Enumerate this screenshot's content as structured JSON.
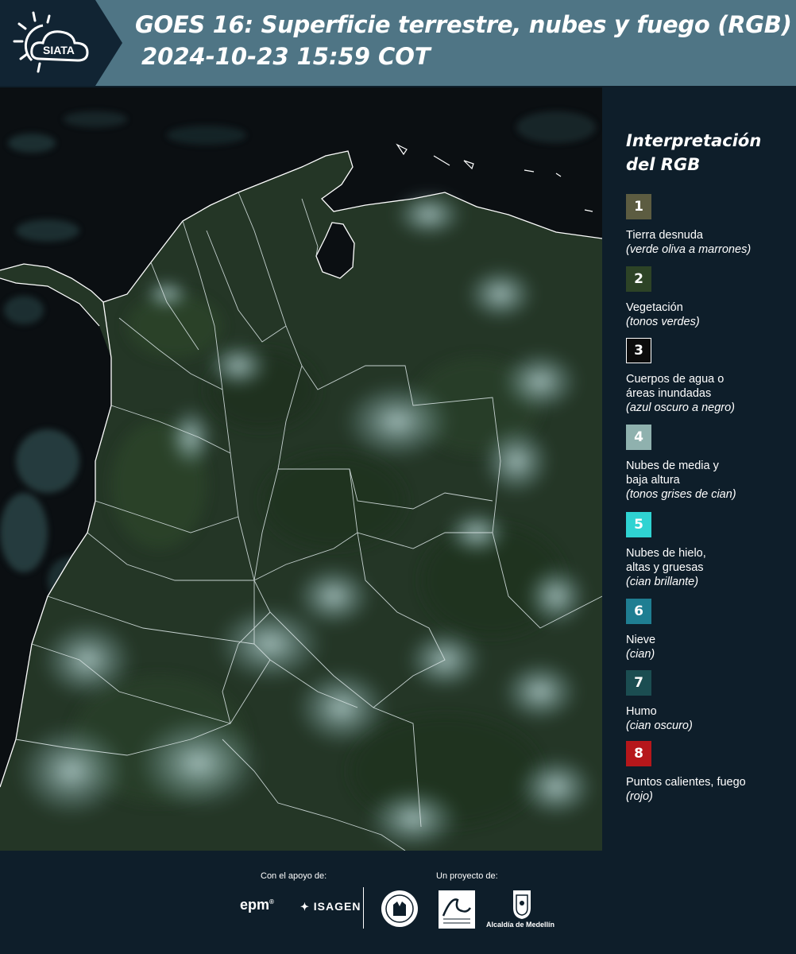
{
  "header": {
    "logo_text": "SIATA",
    "title_line1": "GOES 16: Superficie terrestre, nubes y fuego (RGB)",
    "title_line2": "2024-10-23 15:59 COT"
  },
  "legend": {
    "title": "Interpretación del RGB",
    "items": [
      {
        "num": "1",
        "label": "Tierra desnuda",
        "note": "(verde oliva a marrones)",
        "color": "#5c5c41"
      },
      {
        "num": "2",
        "label": "Vegetación",
        "note": "(tonos verdes)",
        "color": "#2d4326"
      },
      {
        "num": "3",
        "label": "Cuerpos de agua o\náreas inundadas",
        "note": "(azul oscuro a negro)",
        "color": "#0c0c0c"
      },
      {
        "num": "4",
        "label": "Nubes de media y\nbaja altura",
        "note": "(tonos grises de cian)",
        "color": "#8fb1ae"
      },
      {
        "num": "5",
        "label": "Nubes de hielo,\naltas y gruesas",
        "note": "(cian brillante)",
        "color": "#2fd3d2"
      },
      {
        "num": "6",
        "label": "Nieve",
        "note": "(cian)",
        "color": "#1f7e92"
      },
      {
        "num": "7",
        "label": "Humo",
        "note": "(cian oscuro)",
        "color": "#1b4d51"
      },
      {
        "num": "8",
        "label": "Puntos calientes, fuego",
        "note": "(rojo)",
        "color": "#b6171b"
      }
    ]
  },
  "footer": {
    "support_label": "Con el apoyo de:",
    "project_label": "Un proyecto de:",
    "sponsors": [
      "epm",
      "ISAGEN"
    ],
    "partners": [
      "Alcaldía de Medellín"
    ]
  },
  "colors": {
    "header_bg": "#112433",
    "header_band": "#4f7585",
    "page_bg": "#0e1e2a",
    "land": "#243626",
    "ocean": "#0b0f12",
    "cloud": "#9ec3c2"
  }
}
